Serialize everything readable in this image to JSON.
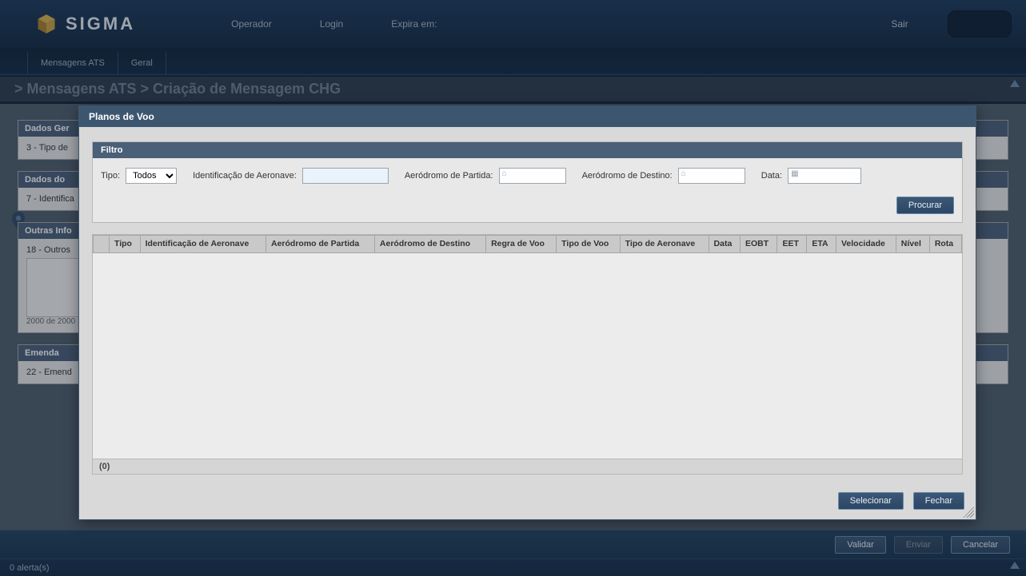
{
  "app": {
    "name": "SIGMA"
  },
  "topbar": {
    "operador_label": "Operador",
    "login_label": "Login",
    "expira_label": "Expira em:",
    "sair_label": "Sair"
  },
  "nav": {
    "tabs": [
      {
        "label": "Mensagens ATS"
      },
      {
        "label": "Geral"
      }
    ]
  },
  "breadcrumb": "> Mensagens ATS > Criação de Mensagem CHG",
  "underlay": {
    "panels": [
      {
        "title": "Dados Ger",
        "row": "3 - Tipo de"
      },
      {
        "title": "Dados do",
        "row": "7 - Identifica"
      },
      {
        "title": "Outras Info",
        "row": "18 - Outros",
        "counter": "2000 de 2000"
      },
      {
        "title": "Emenda",
        "row": "22 - Emend"
      }
    ]
  },
  "footer": {
    "validar": "Validar",
    "enviar": "Enviar",
    "cancelar": "Cancelar",
    "alertas": "0 alerta(s)"
  },
  "modal": {
    "title": "Planos de Voo",
    "filter_title": "Filtro",
    "labels": {
      "tipo": "Tipo:",
      "ident": "Identificação de Aeronave:",
      "aero_partida": "Aeródromo de Partida:",
      "aero_destino": "Aeródromo de Destino:",
      "data": "Data:"
    },
    "tipo_value": "Todos",
    "ident_value": "",
    "partida_value": "",
    "destino_value": "",
    "data_value": "",
    "procurar": "Procurar",
    "columns": [
      "",
      "Tipo",
      "Identificação de Aeronave",
      "Aeródromo de Partida",
      "Aeródromo de Destino",
      "Regra de Voo",
      "Tipo de Voo",
      "Tipo de Aeronave",
      "Data",
      "EOBT",
      "EET",
      "ETA",
      "Velocidade",
      "Nível",
      "Rota"
    ],
    "row_count_text": "(0)",
    "selecionar": "Selecionar",
    "fechar": "Fechar"
  }
}
